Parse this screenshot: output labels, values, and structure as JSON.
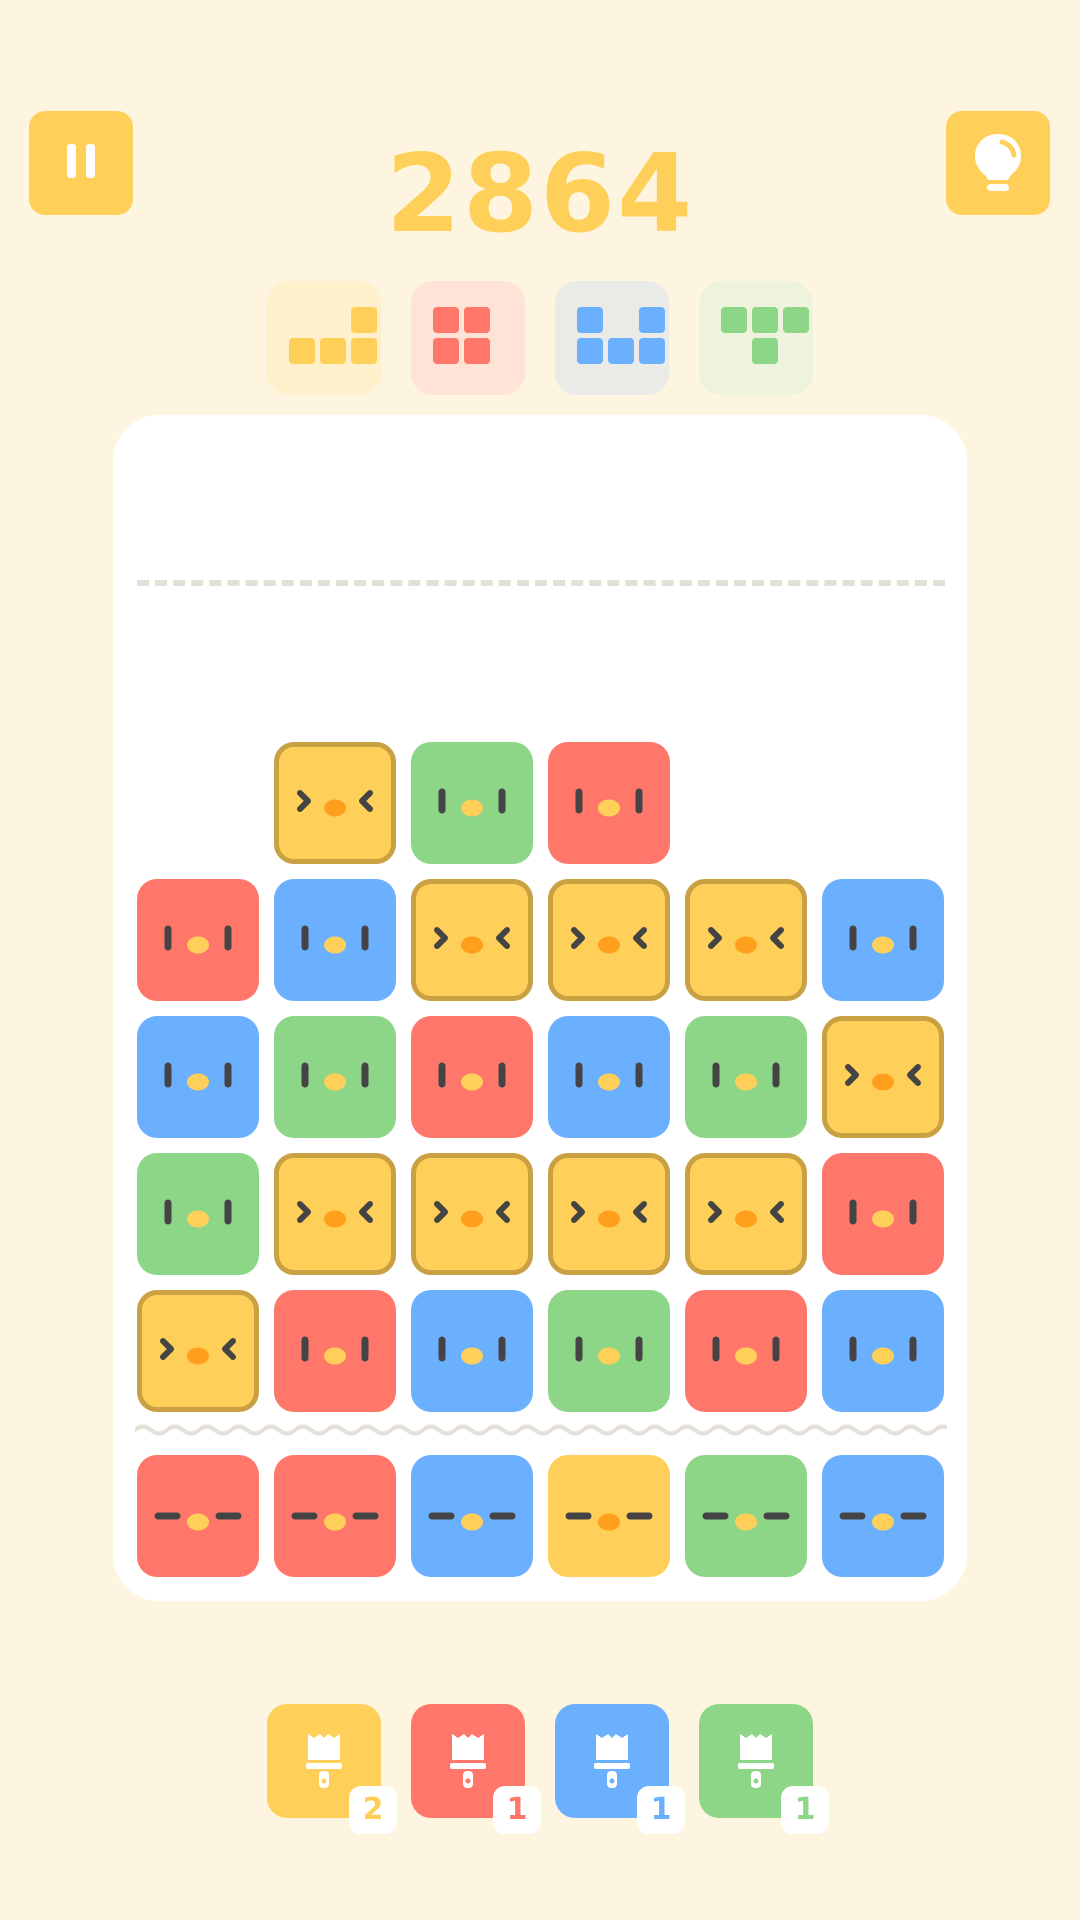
{
  "score": "2864",
  "colors": {
    "yellow": "#FFD059",
    "green": "#8DD587",
    "red": "#FF776B",
    "blue": "#6BB0FF",
    "background": "#FEF5E1",
    "selection_outline": "#C9A042"
  },
  "top_bar": {
    "pause_icon": "pause-icon",
    "hint_icon": "lightbulb-icon"
  },
  "goals": [
    {
      "color": "yellow",
      "shape": "L-piece"
    },
    {
      "color": "red",
      "shape": "square-piece"
    },
    {
      "color": "blue",
      "shape": "J-piece"
    },
    {
      "color": "green",
      "shape": "T-piece"
    }
  ],
  "board_rows": [
    [
      null,
      "yellow",
      "green",
      "red",
      null,
      null
    ],
    [
      "red",
      "blue",
      "yellow",
      "yellow",
      "yellow",
      "blue"
    ],
    [
      "blue",
      "green",
      "red",
      "blue",
      "green",
      "yellow"
    ],
    [
      "green",
      "yellow",
      "yellow",
      "yellow",
      "yellow",
      "red"
    ],
    [
      "yellow",
      "red",
      "blue",
      "green",
      "red",
      "blue"
    ]
  ],
  "next_row": [
    "red",
    "red",
    "blue",
    "yellow",
    "green",
    "blue"
  ],
  "selected_group": [
    [
      0,
      1
    ],
    [
      1,
      2
    ],
    [
      1,
      3
    ],
    [
      1,
      4
    ],
    [
      2,
      5
    ],
    [
      3,
      1
    ],
    [
      3,
      2
    ],
    [
      3,
      3
    ],
    [
      3,
      4
    ],
    [
      4,
      0
    ]
  ],
  "brushes": [
    {
      "color": "yellow",
      "count": "2",
      "icon": "paintbrush-icon"
    },
    {
      "color": "red",
      "count": "1",
      "icon": "paintbrush-icon"
    },
    {
      "color": "blue",
      "count": "1",
      "icon": "paintbrush-icon"
    },
    {
      "color": "green",
      "count": "1",
      "icon": "paintbrush-icon"
    }
  ]
}
